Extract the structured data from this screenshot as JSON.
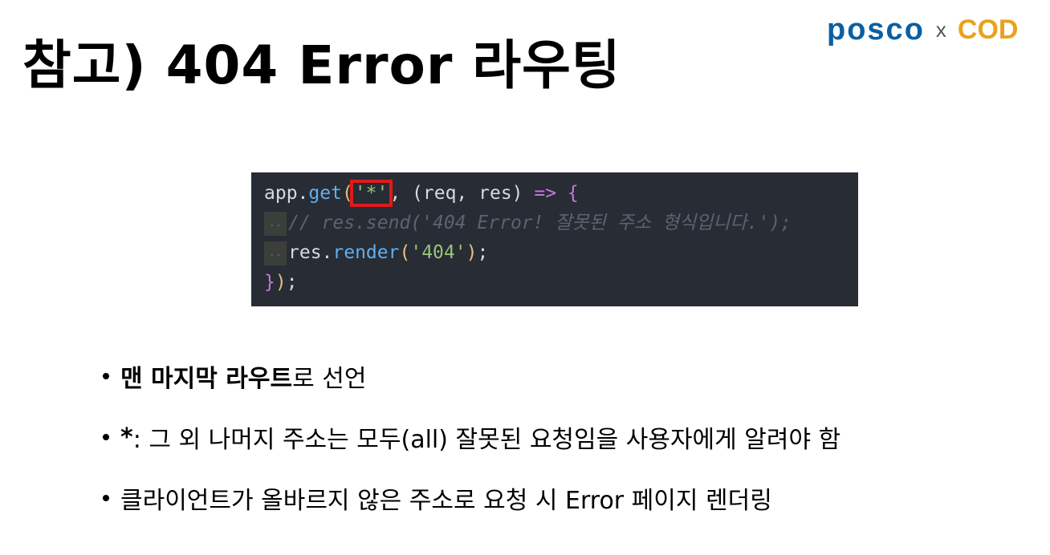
{
  "slide": {
    "title": "참고) 404 Error 라우팅",
    "logo": {
      "left": "posco",
      "separator": "x",
      "right": "COD"
    }
  },
  "code": {
    "line1": {
      "prefix": "app.",
      "fn": "get",
      "open": "(",
      "str": "'*'",
      "mid": ", (req, res) ",
      "arrow": "=>",
      "brace": " {"
    },
    "line2": {
      "comment": "// res.send('404 Error! 잘못된 주소 형식입니다.');"
    },
    "line3": {
      "obj": "res.",
      "fn": "render",
      "open": "(",
      "str": "'404'",
      "close": ")",
      "end": ";"
    },
    "line4": {
      "brace": "}",
      "close": ")",
      "end": ";"
    },
    "guide_char": "··"
  },
  "bullets": [
    {
      "bold": "맨 마지막 라우트",
      "text": "로 선언"
    },
    {
      "bold": "*",
      "text": " : 그 외 나머지 주소는 모두(all) 잘못된 요청임을 사용자에게 알려야 함"
    },
    {
      "bold": "",
      "text": "클라이언트가 올바르지 않은 주소로 요청 시 Error 페이지 렌더링"
    }
  ],
  "colors": {
    "highlight_box": "#e01a1a",
    "code_bg": "#282c34",
    "logo_blue": "#0a5fa3",
    "logo_orange": "#e8a21c"
  }
}
